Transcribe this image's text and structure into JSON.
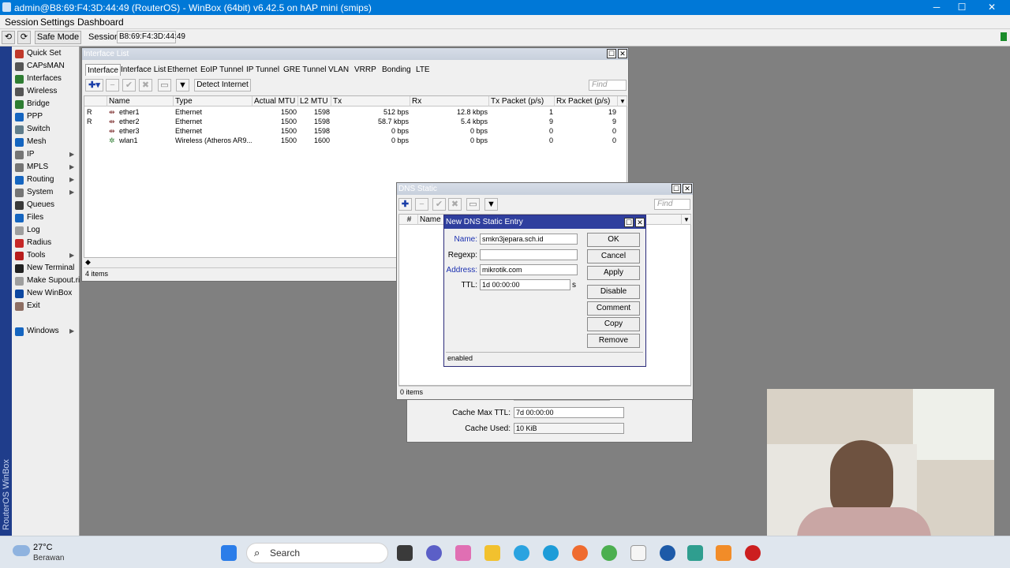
{
  "titlebar": {
    "title": "admin@B8:69:F4:3D:44:49 (RouterOS) - WinBox (64bit) v6.42.5 on hAP mini (smips)",
    "minimize": "─",
    "maximize": "☐",
    "close": "✕"
  },
  "menu": [
    "Session",
    "Settings",
    "Dashboard"
  ],
  "toolbar": {
    "undo": "⟲",
    "redo": "⟳",
    "safe_mode": "Safe Mode",
    "session_label": "Session:",
    "session_value": "B8:69:F4:3D:44:49"
  },
  "sideband_text": "RouterOS WinBox",
  "sidebar": [
    {
      "label": "Quick Set",
      "icon": "quickset-icon",
      "color": "#c0392b",
      "arrow": false
    },
    {
      "label": "CAPsMAN",
      "icon": "capsman-icon",
      "color": "#555555",
      "arrow": false
    },
    {
      "label": "Interfaces",
      "icon": "interfaces-icon",
      "color": "#2e7d32",
      "arrow": false
    },
    {
      "label": "Wireless",
      "icon": "wireless-icon",
      "color": "#555555",
      "arrow": false
    },
    {
      "label": "Bridge",
      "icon": "bridge-icon",
      "color": "#2e7d32",
      "arrow": false
    },
    {
      "label": "PPP",
      "icon": "ppp-icon",
      "color": "#1565c0",
      "arrow": false
    },
    {
      "label": "Switch",
      "icon": "switch-icon",
      "color": "#607d8b",
      "arrow": false
    },
    {
      "label": "Mesh",
      "icon": "mesh-icon",
      "color": "#1565c0",
      "arrow": false
    },
    {
      "label": "IP",
      "icon": "ip-icon",
      "color": "#757575",
      "arrow": true
    },
    {
      "label": "MPLS",
      "icon": "mpls-icon",
      "color": "#757575",
      "arrow": true
    },
    {
      "label": "Routing",
      "icon": "routing-icon",
      "color": "#1565c0",
      "arrow": true
    },
    {
      "label": "System",
      "icon": "system-icon",
      "color": "#757575",
      "arrow": true
    },
    {
      "label": "Queues",
      "icon": "queues-icon",
      "color": "#3a3a3a",
      "arrow": false
    },
    {
      "label": "Files",
      "icon": "files-icon",
      "color": "#1565c0",
      "arrow": false
    },
    {
      "label": "Log",
      "icon": "log-icon",
      "color": "#9e9e9e",
      "arrow": false
    },
    {
      "label": "Radius",
      "icon": "radius-icon",
      "color": "#c62828",
      "arrow": false
    },
    {
      "label": "Tools",
      "icon": "tools-icon",
      "color": "#b71c1c",
      "arrow": true
    },
    {
      "label": "New Terminal",
      "icon": "terminal-icon",
      "color": "#212121",
      "arrow": false
    },
    {
      "label": "Make Supout.rif",
      "icon": "supout-icon",
      "color": "#9e9e9e",
      "arrow": false
    },
    {
      "label": "New WinBox",
      "icon": "winbox-icon",
      "color": "#0d47a1",
      "arrow": false
    },
    {
      "label": "Exit",
      "icon": "exit-icon",
      "color": "#8d6e63",
      "arrow": false
    }
  ],
  "sidebar_windows": {
    "label": "Windows",
    "icon": "windows-icon",
    "color": "#1565c0"
  },
  "interface_list": {
    "title": "Interface List",
    "tabs": [
      "Interface",
      "Interface List",
      "Ethernet",
      "EoIP Tunnel",
      "IP Tunnel",
      "GRE Tunnel",
      "VLAN",
      "VRRP",
      "Bonding",
      "LTE"
    ],
    "detect": "Detect Internet",
    "find_placeholder": "Find",
    "columns": [
      "Name",
      "Type",
      "Actual MTU",
      "L2 MTU",
      "Tx",
      "Rx",
      "Tx Packet (p/s)",
      "Rx Packet (p/s)"
    ],
    "rows": [
      {
        "flag": "R",
        "name": "ether1",
        "type": "Ethernet",
        "mtu": "1500",
        "l2mtu": "1598",
        "tx": "512 bps",
        "rx": "12.8 kbps",
        "txp": "1",
        "rxp": "19"
      },
      {
        "flag": "R",
        "name": "ether2",
        "type": "Ethernet",
        "mtu": "1500",
        "l2mtu": "1598",
        "tx": "58.7 kbps",
        "rx": "5.4 kbps",
        "txp": "9",
        "rxp": "9"
      },
      {
        "flag": "",
        "name": "ether3",
        "type": "Ethernet",
        "mtu": "1500",
        "l2mtu": "1598",
        "tx": "0 bps",
        "rx": "0 bps",
        "txp": "0",
        "rxp": "0"
      },
      {
        "flag": "",
        "name": "wlan1",
        "type": "Wireless (Atheros AR9...",
        "mtu": "1500",
        "l2mtu": "1600",
        "tx": "0 bps",
        "rx": "0 bps",
        "txp": "0",
        "rxp": "0"
      }
    ],
    "status": "4 items"
  },
  "dns_settings": {
    "cache_max_ttl_label": "Cache Max TTL:",
    "cache_max_ttl": "7d 00:00:00",
    "cache_used_label": "Cache Used:",
    "cache_used": "10 KiB"
  },
  "dns_static": {
    "title": "DNS Static",
    "find_placeholder": "Find",
    "col_hash": "#",
    "col_name": "Name",
    "status": "0 items"
  },
  "dns_entry": {
    "title": "New DNS Static Entry",
    "name_label": "Name:",
    "name_value": "smkn3jepara.sch.id",
    "regexp_label": "Regexp:",
    "regexp_value": "",
    "address_label": "Address:",
    "address_value": "mikrotik.com",
    "ttl_label": "TTL:",
    "ttl_value": "1d 00:00:00",
    "ttl_unit": "s",
    "buttons": [
      "OK",
      "Cancel",
      "Apply",
      "Disable",
      "Comment",
      "Copy",
      "Remove"
    ],
    "status": "enabled"
  },
  "taskbar": {
    "temp": "27°C",
    "weather": "Berawan",
    "search": "Search"
  }
}
